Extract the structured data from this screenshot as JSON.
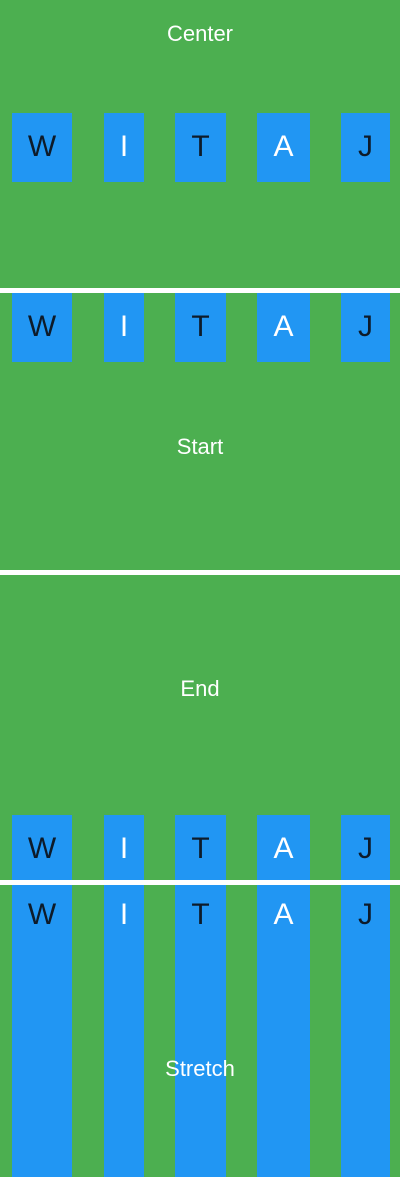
{
  "colors": {
    "panel_background": "#4caf50",
    "tile_background": "#2196f3",
    "divider": "#ffffff",
    "title_text": "#ffffff",
    "tile_text_dark": "#0d1b2a",
    "tile_text_light": "#ffffff"
  },
  "sections": {
    "center": {
      "title": "Center",
      "tiles": [
        "W",
        "I",
        "T",
        "A",
        "J"
      ]
    },
    "start": {
      "title": "Start",
      "tiles": [
        "W",
        "I",
        "T",
        "A",
        "J"
      ]
    },
    "end": {
      "title": "End",
      "tiles": [
        "W",
        "I",
        "T",
        "A",
        "J"
      ]
    },
    "stretch": {
      "title": "Stretch",
      "tiles": [
        "W",
        "I",
        "T",
        "A",
        "J"
      ]
    }
  }
}
